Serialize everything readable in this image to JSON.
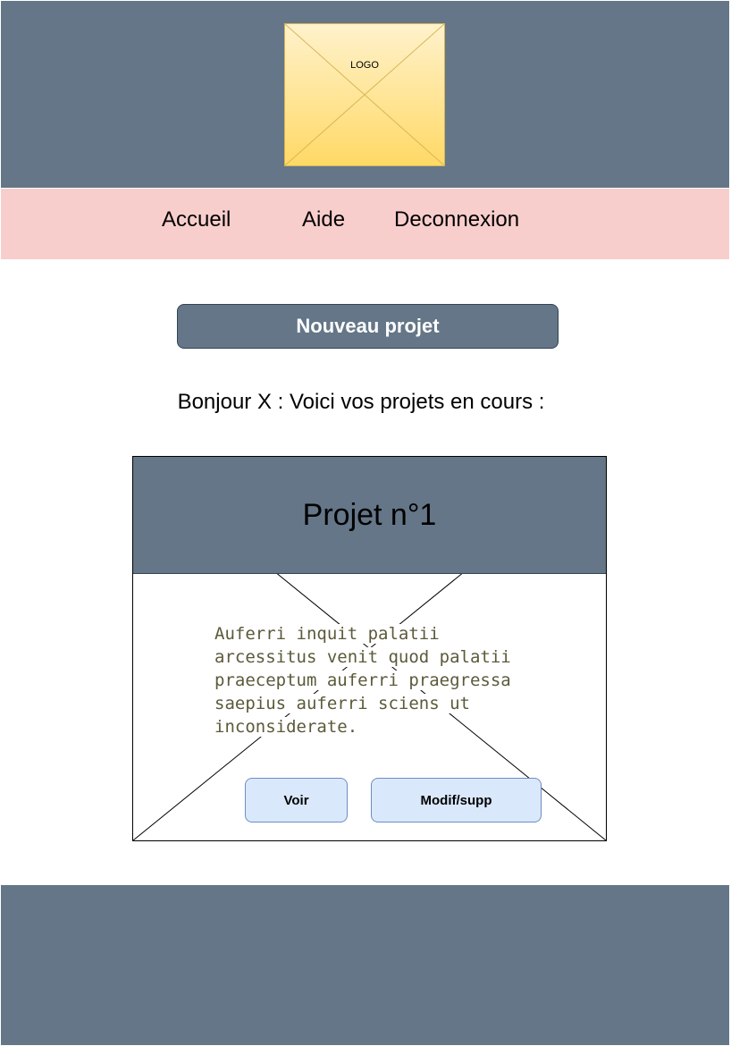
{
  "header": {
    "logo_text": "LOGO"
  },
  "nav": {
    "items": [
      {
        "label": "Accueil"
      },
      {
        "label": "Aide"
      },
      {
        "label": "Deconnexion"
      }
    ]
  },
  "actions": {
    "new_project_label": "Nouveau projet"
  },
  "greeting": "Bonjour X : Voici vos projets en cours  :",
  "project_card": {
    "title": "Projet n°1",
    "description": "Auferri inquit palatii arcessitus venit quod palatii praeceptum auferri praegressa saepius auferri sciens ut inconsiderate.",
    "buttons": {
      "view": "Voir",
      "edit": "Modif/supp"
    }
  },
  "colors": {
    "header_bg": "#647687",
    "nav_bg": "#f8cecc",
    "logo_fill": "#fff2cc",
    "button_fill": "#dae8fc"
  }
}
